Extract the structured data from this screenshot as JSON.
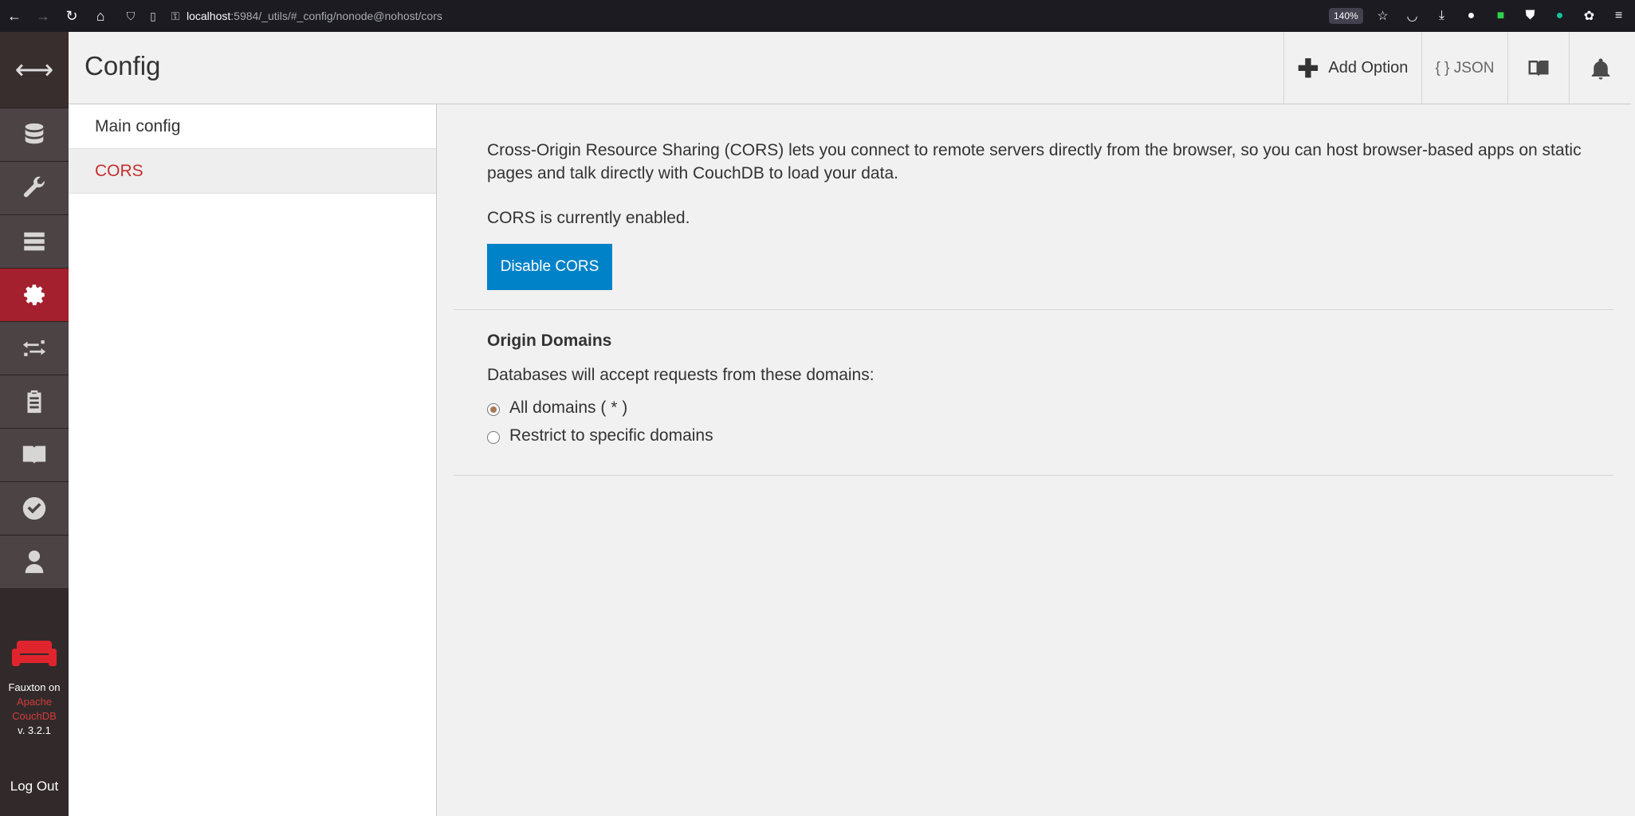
{
  "browser": {
    "url_host": "localhost",
    "url_rest": ":5984/_utils/#_config/nonode@nohost/cors",
    "zoom": "140%"
  },
  "nav": {
    "footer_line1": "Fauxton on",
    "footer_link1": "Apache",
    "footer_link2": "CouchDB",
    "footer_version": "v. 3.2.1",
    "logout": "Log Out"
  },
  "header": {
    "title": "Config",
    "add_option": "Add Option",
    "json": "{ } JSON"
  },
  "sidebar": {
    "items": [
      {
        "label": "Main config"
      },
      {
        "label": "CORS"
      }
    ]
  },
  "main": {
    "intro": "Cross-Origin Resource Sharing (CORS) lets you connect to remote servers directly from the browser, so you can host browser-based apps on static pages and talk directly with CouchDB to load your data.",
    "status": "CORS is currently enabled.",
    "disable_button": "Disable CORS",
    "origin_title": "Origin Domains",
    "origin_desc": "Databases will accept requests from these domains:",
    "options": [
      {
        "label": "All domains ( * )",
        "selected": true
      },
      {
        "label": "Restrict to specific domains",
        "selected": false
      }
    ]
  },
  "colors": {
    "accent_red": "#a4202e",
    "primary_button": "#0082c8",
    "nav_bg": "#322a2a"
  }
}
